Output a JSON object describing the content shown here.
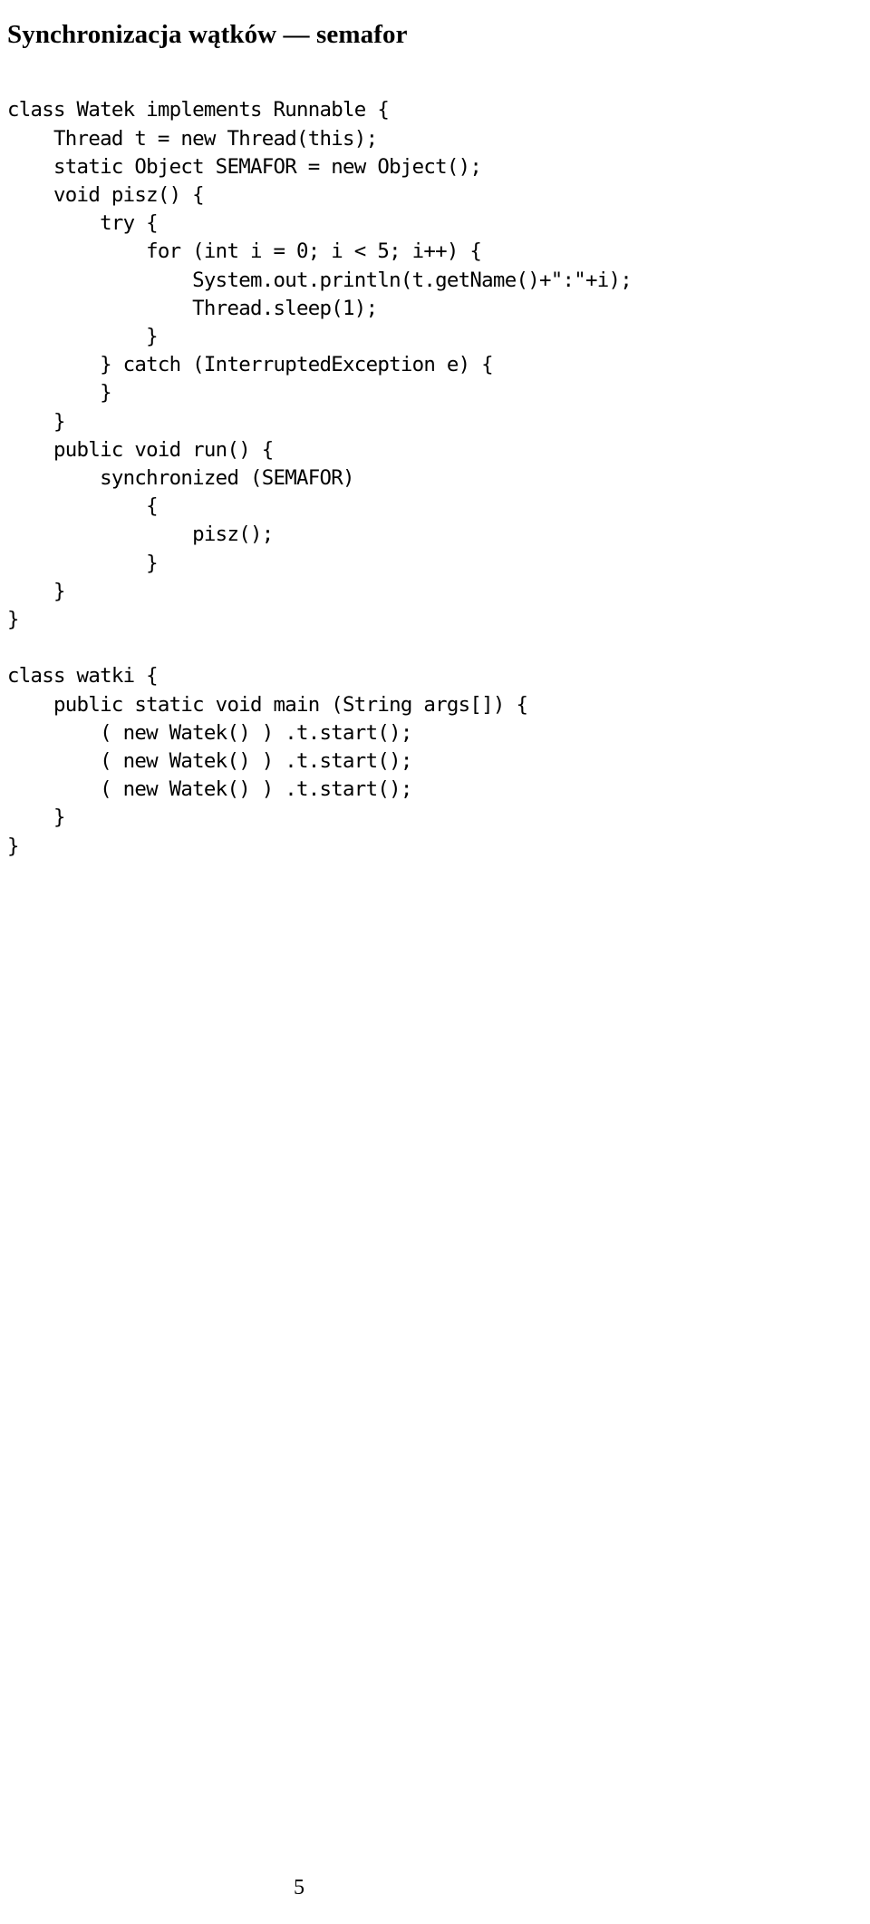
{
  "document": {
    "title": "Synchronizacja wątków — semafor",
    "page_number": "5",
    "text_color": "#000000",
    "background_color": "#ffffff"
  },
  "code": {
    "language": "java",
    "lines": [
      "class Watek implements Runnable {",
      "    Thread t = new Thread(this);",
      "    static Object SEMAFOR = new Object();",
      "    void pisz() {",
      "        try {",
      "            for (int i = 0; i < 5; i++) {",
      "                System.out.println(t.getName()+\":\"+i);",
      "                Thread.sleep(1);",
      "            }",
      "        } catch (InterruptedException e) {",
      "        }",
      "    }",
      "    public void run() {",
      "        synchronized (SEMAFOR)",
      "            {",
      "                pisz();",
      "            }",
      "    }",
      "}",
      "",
      "class watki {",
      "    public static void main (String args[]) {",
      "        ( new Watek() ) .t.start();",
      "        ( new Watek() ) .t.start();",
      "        ( new Watek() ) .t.start();",
      "    }",
      "}"
    ]
  }
}
